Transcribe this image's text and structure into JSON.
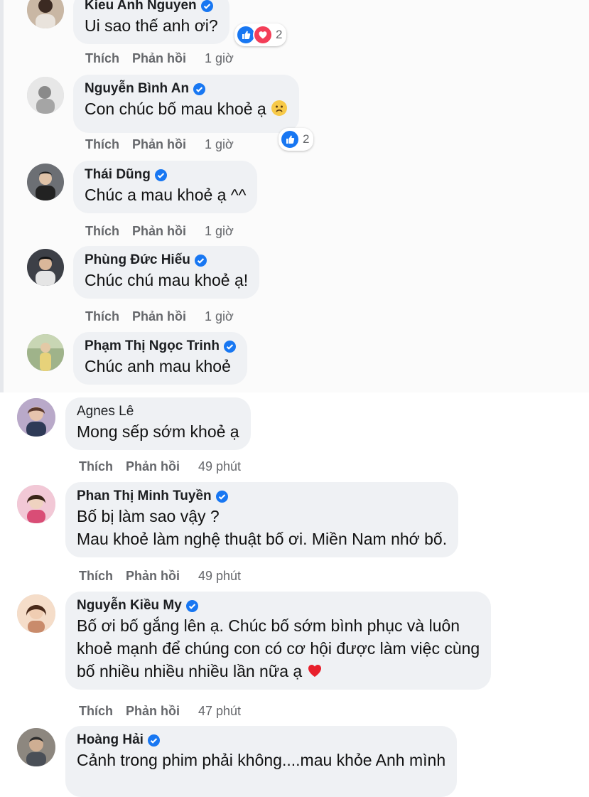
{
  "actions": {
    "like": "Thích",
    "reply": "Phản hồi"
  },
  "colors": {
    "verified": "#1877f2",
    "like": "#1877f2",
    "love": "#f33e58",
    "bubble": "#eff1f4"
  },
  "comments": [
    {
      "name": "Kieu Anh Nguyen",
      "verified": true,
      "lines": [
        "Ui sao thế anh ơi?"
      ],
      "time": "1 giờ",
      "reactions": {
        "icons": [
          "like-icon",
          "love-icon"
        ],
        "count": "2"
      }
    },
    {
      "name": "Nguyễn Bình An",
      "verified": true,
      "lines": [
        "Con chúc bố mau khoẻ ạ"
      ],
      "emoji": "sad-face-emoji",
      "time": "1 giờ",
      "reactions": {
        "icons": [
          "like-icon"
        ],
        "count": "2"
      }
    },
    {
      "name": "Thái Dũng",
      "verified": true,
      "lines": [
        "Chúc a mau khoẻ ạ ^^"
      ],
      "time": "1 giờ"
    },
    {
      "name": "Phùng Đức Hiếu",
      "verified": true,
      "lines": [
        "Chúc chú mau khoẻ ạ!"
      ],
      "time": "1 giờ"
    },
    {
      "name": "Phạm Thị Ngọc Trinh",
      "verified": true,
      "lines": [
        "Chúc anh mau khoẻ"
      ]
    },
    {
      "name": "Agnes Lê",
      "verified": false,
      "lines": [
        "Mong sếp sớm khoẻ ạ"
      ],
      "time": "49 phút"
    },
    {
      "name": "Phan Thị Minh Tuyền",
      "verified": true,
      "lines": [
        "Bố bị làm sao vậy ?",
        "Mau khoẻ làm nghệ thuật bố ơi. Miền Nam nhớ bố."
      ],
      "time": "49 phút"
    },
    {
      "name": "Nguyễn Kiều My",
      "verified": true,
      "lines": [
        "Bố ơi bố gắng lên ạ. Chúc bố sớm bình phục và luôn",
        "khoẻ mạnh để chúng con có cơ hội được làm việc cùng",
        "bố nhiều nhiều nhiều lần nữa ạ"
      ],
      "emoji": "red-heart-emoji",
      "time": "47 phút"
    },
    {
      "name": "Hoàng Hải",
      "verified": true,
      "lines": [
        "Cảnh trong phim phải không....mau khỏe Anh mình"
      ]
    }
  ]
}
